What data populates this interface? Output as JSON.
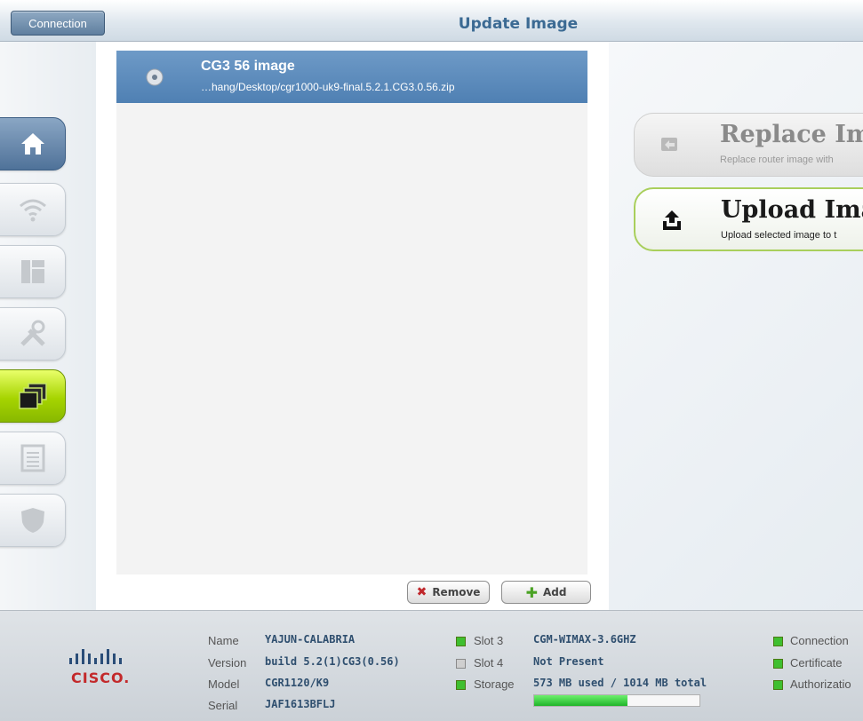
{
  "titlebar": {
    "connection_button": "Connection",
    "title": "Update Image"
  },
  "sidebar": {
    "items": [
      {
        "name": "home",
        "icon": "home-icon",
        "active": false,
        "highlight": "blue"
      },
      {
        "name": "wireless",
        "icon": "wifi-icon",
        "active": false
      },
      {
        "name": "dashboard",
        "icon": "layout-icon",
        "active": false
      },
      {
        "name": "tools",
        "icon": "tools-icon",
        "active": false
      },
      {
        "name": "images",
        "icon": "stack-icon",
        "active": true
      },
      {
        "name": "logs",
        "icon": "list-icon",
        "active": false
      },
      {
        "name": "security",
        "icon": "shield-icon",
        "active": false
      }
    ]
  },
  "image_list": {
    "items": [
      {
        "title": "CG3  56 image",
        "path": "…hang/Desktop/cgr1000-uk9-final.5.2.1.CG3.0.56.zip",
        "selected": true
      }
    ],
    "remove_label": "Remove",
    "add_label": "Add"
  },
  "actions": {
    "replace": {
      "title": "Replace Ima",
      "desc": "Replace router image with",
      "enabled": false
    },
    "upload": {
      "title": "Upload Imag",
      "desc": "Upload selected image to t",
      "enabled": true
    }
  },
  "footer": {
    "brand": "CISCO.",
    "device": {
      "name_label": "Name",
      "name": "YAJUN-CALABRIA",
      "version_label": "Version",
      "version": "build 5.2(1)CG3(0.56)",
      "model_label": "Model",
      "model": "CGR1120/K9",
      "serial_label": "Serial",
      "serial": "JAF1613BFLJ"
    },
    "slots": {
      "slot3_label": "Slot 3",
      "slot3": "CGM-WIMAX-3.6GHZ",
      "slot4_label": "Slot 4",
      "slot4": "Not Present",
      "storage_label": "Storage",
      "storage": "573 MB used / 1014 MB total",
      "storage_fraction": 0.565
    },
    "status": {
      "connection": "Connection",
      "certificate": "Certificate",
      "authorization": "Authorizatio"
    }
  },
  "colors": {
    "accent_blue": "#4f80b3",
    "active_green": "#a6d400",
    "led_green": "#3fbf2f",
    "cisco_red": "#c3292b"
  }
}
